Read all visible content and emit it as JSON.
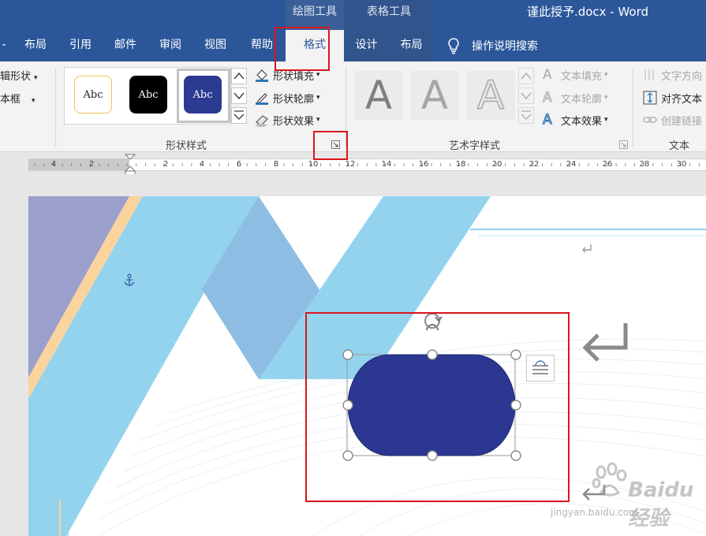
{
  "window": {
    "title": "谨此授予.docx  -  Word"
  },
  "context_groups": {
    "drawing_tools": "绘图工具",
    "table_tools": "表格工具"
  },
  "tabs": {
    "layout": "布局",
    "references": "引用",
    "mailings": "邮件",
    "review": "审阅",
    "view": "视图",
    "help": "帮助",
    "format": "格式",
    "design": "设计",
    "table_layout": "布局"
  },
  "tell_me": "操作说明搜索",
  "ribbon": {
    "partial_left": {
      "edit_shape": "辑形状",
      "textbox": "本框"
    },
    "shape_styles": {
      "samples": [
        "Abc",
        "Abc",
        "Abc"
      ],
      "fill": "形状填充",
      "outline": "形状轮廓",
      "effects": "形状效果",
      "label": "形状样式"
    },
    "wordart_styles": {
      "sample_letter": "A",
      "text_fill": "文本填充",
      "text_outline": "文本轮廓",
      "text_effects": "文本效果",
      "label": "艺术字样式"
    },
    "text": {
      "direction": "文字方向",
      "align": "对齐文本",
      "link": "创建链接",
      "label": "文本"
    }
  },
  "ruler": {
    "numbers": [
      "4",
      "2",
      "2",
      "4",
      "6",
      "8",
      "10",
      "12",
      "14",
      "16",
      "18",
      "20",
      "22",
      "24",
      "26",
      "28",
      "30"
    ]
  },
  "document": {
    "shape_fill": "#2c3791",
    "band_color": "#93d3ee"
  },
  "watermark": {
    "brand": "Baidu经验",
    "url": "jingyan.baidu.com"
  },
  "colors": {
    "ribbon_blue": "#2b579a",
    "highlight_red": "#d9161b"
  }
}
